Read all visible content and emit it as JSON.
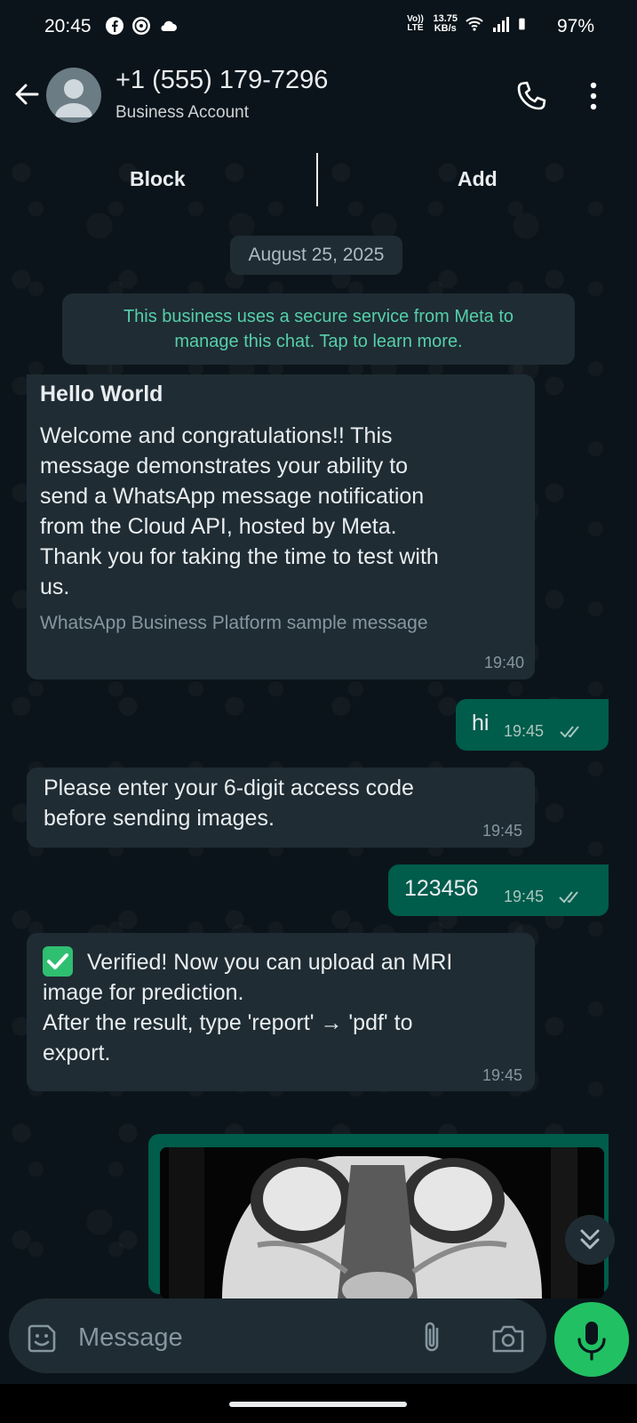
{
  "status_bar": {
    "time": "20:45",
    "network_label": "Vo)) LTE",
    "speed_value": "13.75",
    "speed_unit": "KB/s",
    "battery": "97%"
  },
  "header": {
    "contact_name": "+1 (555) 179-7296",
    "contact_subtitle": "Business Account"
  },
  "actions": {
    "block_label": "Block",
    "add_label": "Add"
  },
  "chat": {
    "date_chip": "August 25, 2025",
    "system_message_line1": "This business uses a secure service from Meta to",
    "system_message_line2": "manage this chat. Tap to learn more.",
    "messages": [
      {
        "direction": "in",
        "title": "Hello World",
        "lines": [
          "Welcome and congratulations!! This",
          "message demonstrates your ability to",
          "send a WhatsApp message notification",
          "from the Cloud API, hosted by Meta.",
          "Thank you for taking the time to test with",
          "us."
        ],
        "footer": "WhatsApp Business Platform sample message",
        "time": "19:40"
      },
      {
        "direction": "out",
        "text": "hi",
        "time": "19:45"
      },
      {
        "direction": "in",
        "lines": [
          "Please enter your 6-digit access code",
          "before sending images."
        ],
        "time": "19:45"
      },
      {
        "direction": "out",
        "text": "123456",
        "time": "19:45"
      },
      {
        "direction": "in",
        "lines": [
          "Verified! Now you can upload an MRI",
          "image for prediction.",
          "After the result, type 'report' → 'pdf' to",
          "export."
        ],
        "time": "19:45"
      }
    ]
  },
  "composer": {
    "placeholder": "Message"
  },
  "colors": {
    "background": "#0b141a",
    "incoming_bubble": "#1f2c34",
    "outgoing_bubble": "#005c4b",
    "accent_green": "#21c063",
    "system_text": "#56cfaa"
  }
}
